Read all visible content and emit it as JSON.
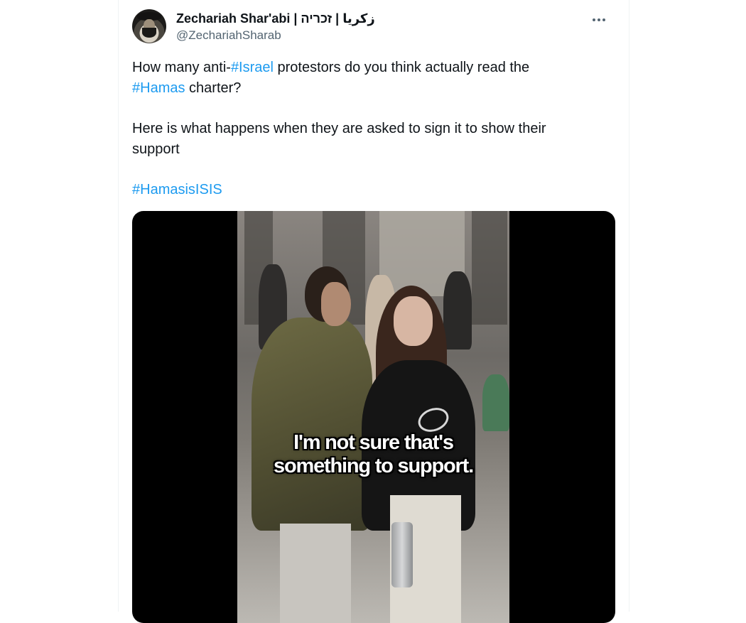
{
  "tweet": {
    "author": {
      "display_name": "Zechariah Shar'abi | زكريا | זכריה",
      "handle": "@ZechariahSharab"
    },
    "text": {
      "line1_prefix": "How many anti-",
      "tag_israel": "#Israel",
      "line1_suffix": " protestors do you think actually read the",
      "tag_hamas": "#Hamas",
      "line2_suffix": " charter?",
      "paragraph2": "Here is what happens when they are asked to sign it to show their support",
      "tag_hamasisisis": "#HamasisISIS"
    },
    "media": {
      "caption_line1": "I'm not sure that's",
      "caption_line2": "something to support."
    }
  },
  "colors": {
    "link": "#1d9bf0",
    "text": "#0f1419",
    "secondary": "#536471",
    "media_bg": "#000000"
  },
  "icons": {
    "more": "more-horizontal-icon"
  }
}
